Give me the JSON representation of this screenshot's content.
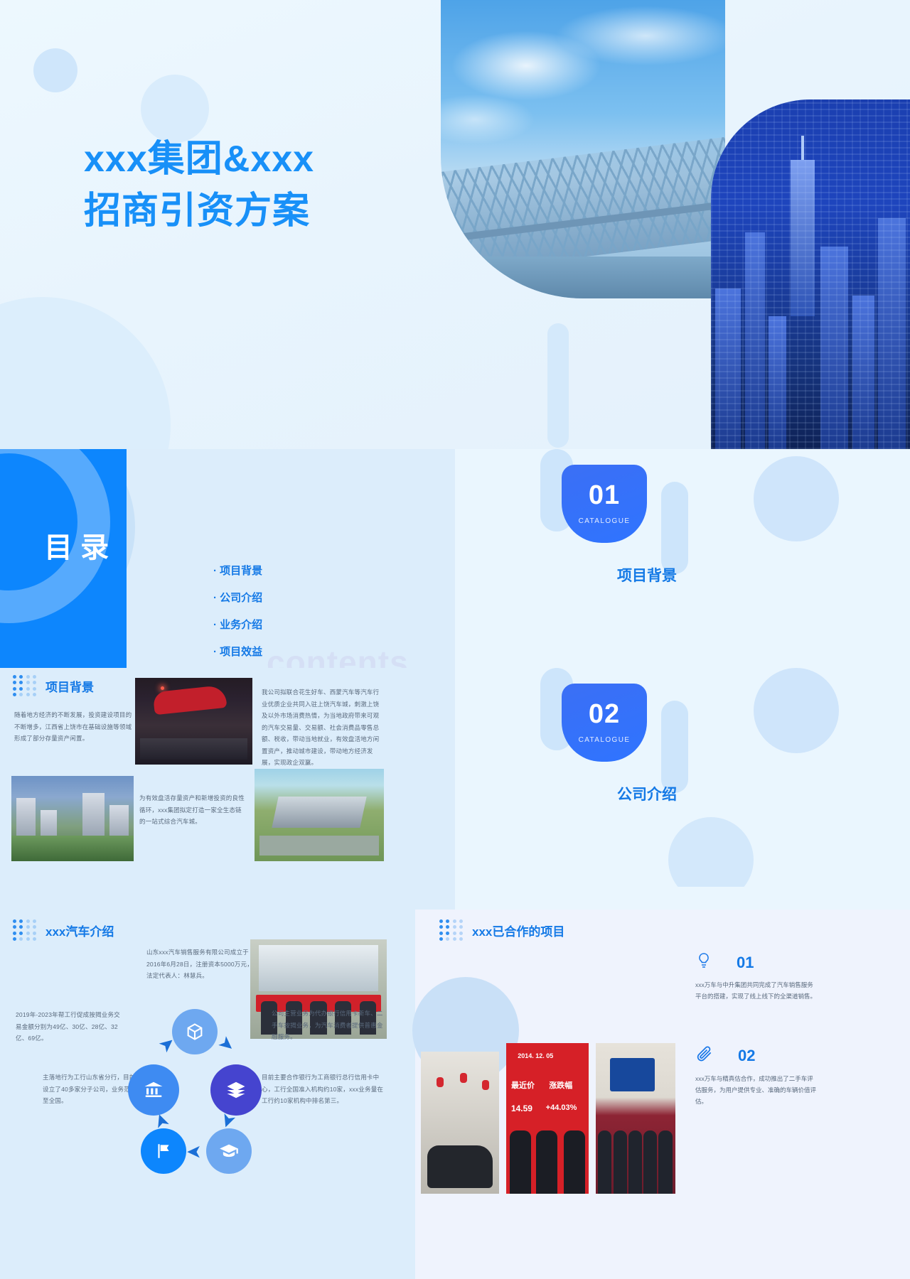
{
  "cover": {
    "title_line1": "xxx集团&xxx",
    "title_line2": "招商引资方案",
    "accent": "#1890f8"
  },
  "catalogue": {
    "label": "目 录",
    "watermark": "contents",
    "items": [
      {
        "label": "项目背景"
      },
      {
        "label": "公司介绍"
      },
      {
        "label": "业务介绍"
      },
      {
        "label": "项目效益"
      }
    ]
  },
  "sections": [
    {
      "number": "01",
      "caption": "CATALOGUE",
      "title": "项目背景"
    },
    {
      "number": "02",
      "caption": "CATALOGUE",
      "title": "公司介绍"
    }
  ],
  "background_block": {
    "heading": "项目背景",
    "para_left": "随着地方经济的不断发展，投资建设项目的不断增多，江西省上饶市在基础设施等领域形成了部分存量资产闲置。",
    "para_right": "我公司拟联合花生好车、西蒙汽车等汽车行业优质企业共同入驻上饶汽车城，刺激上饶及以外市场消费热情，为当地政府带来可观的汽车交易量、交易额、社会消费品零售总额、税收，带动当地就业，有效盘活地方闲置资产，推动城市建设，带动地方经济发展，实现政企双赢。",
    "para_bottom": "为有效盘活存量资产和新增投资的良性循环，xxx集团拟定打造一家全生态链的一站式综合汽车城。"
  },
  "car_block": {
    "heading": "xxx汽车介绍",
    "texts": {
      "top_right": "山东xxx汽车销售服务有限公司成立于2016年6月28日，注册资本5000万元，法定代表人：林慧兵。",
      "mid_left": "2019年-2023年帮工行促成按揭业务交易金额分别为49亿、30亿、28亿、32亿、69亿。",
      "mid_right": "公司主营业务为代办银行信用卡新车、二手车按揭业务，为汽车消费者提供普惠金融服务。",
      "bot_left": "主落地行为工行山东省分行，目前已经设立了40多家分子公司，业务范围拓展至全国。",
      "bot_right": "目前主要合作银行为工商银行总行信用卡中心，工行全国准入机构约10家，xxx业务量在工行约10家机构中排名第三。"
    },
    "cycle_icons": [
      "box-icon",
      "bank-icon",
      "layers-icon",
      "graduation-icon",
      "flag-icon"
    ]
  },
  "coop_block": {
    "heading": "xxx已合作的项目",
    "stock_photo": {
      "date": "2014. 12. 05",
      "col1": "最近价",
      "col2": "涨跌幅",
      "val1": "14.59",
      "val2": "+44.03%"
    },
    "items": [
      {
        "icon": "lightbulb-icon",
        "number": "01",
        "text": "xxx万车与中升集团共同完成了汽车销售服务平台的搭建，实现了线上线下的全渠道销售。"
      },
      {
        "icon": "paperclip-icon",
        "number": "02",
        "text": "xxx万车与精真估合作，成功推出了二手车评估服务，为用户提供专业、准确的车辆价值评估。"
      }
    ]
  }
}
